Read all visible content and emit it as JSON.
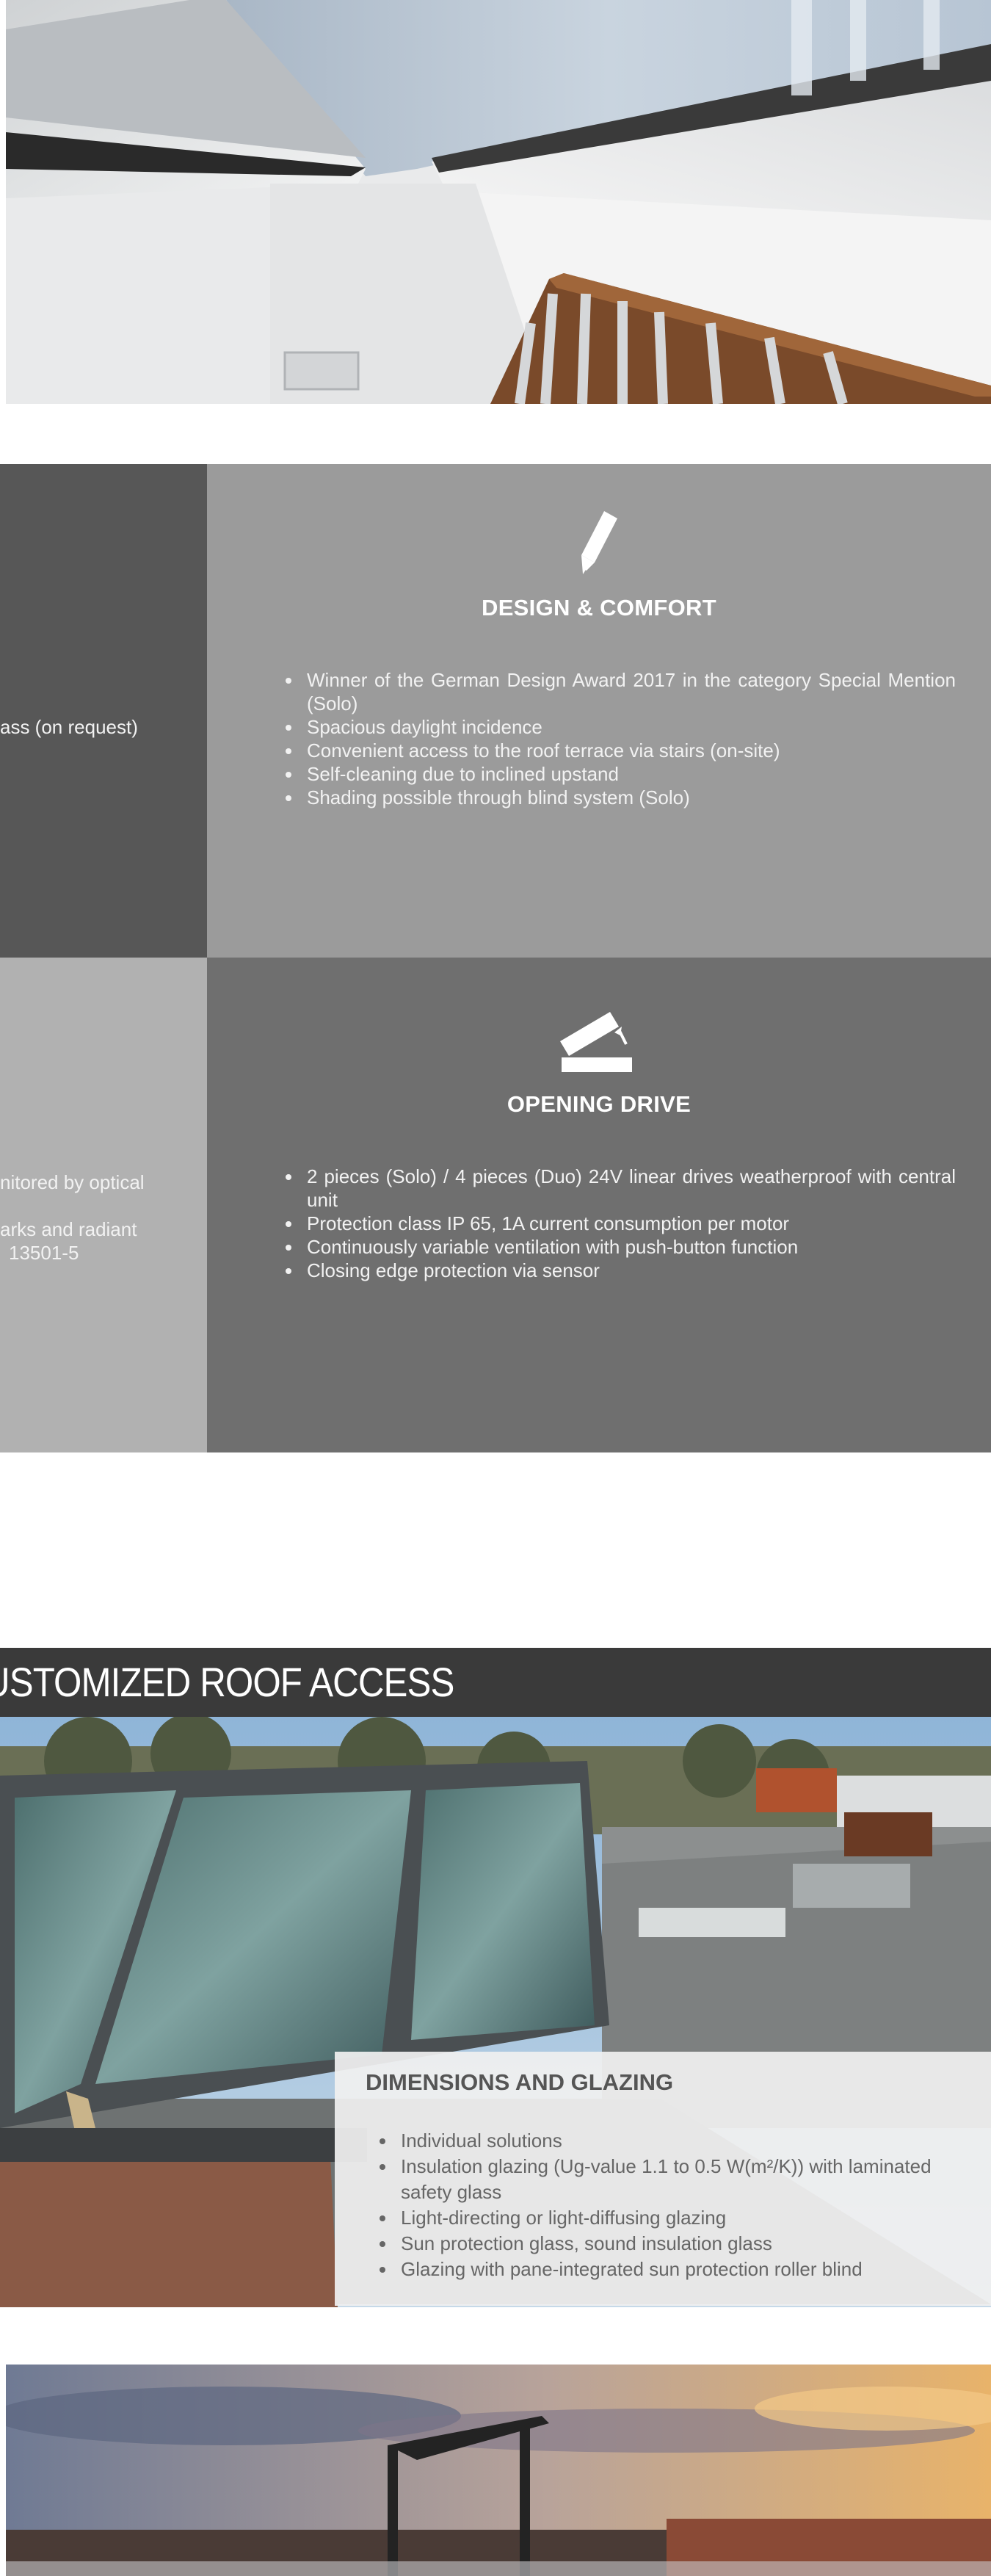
{
  "design_comfort": {
    "title": "DESIGN & COMFORT",
    "icon": "pencil-icon",
    "items": [
      "Winner of the German Design Award 2017 in the category Special Mention (Solo)",
      "Spacious daylight incidence",
      "Convenient access to the roof terrace via stairs (on-site)",
      "Self-cleaning due to inclined upstand",
      "Shading possible through blind system (Solo)"
    ]
  },
  "left_dark_cell": {
    "fragment": "ass (on request)"
  },
  "opening_drive": {
    "title": "OPENING DRIVE",
    "icon": "opening-window-icon",
    "items": [
      "2 pieces (Solo) / 4 pieces (Duo) 24V linear drives weatherproof with central unit",
      "Protection class IP 65, 1A current consumption per motor",
      "Continuously variable ventilation with push-button function",
      "Closing edge protection via sensor"
    ]
  },
  "left_light_cell": {
    "fragment_1": "nitored by optical",
    "fragment_2": "arks and radiant",
    "fragment_3": "13501-5"
  },
  "banner": {
    "title": "USTOMIZED ROOF ACCESS"
  },
  "glazing": {
    "title": "DIMENSIONS AND GLAZING",
    "items": [
      "Individual solutions",
      "Insulation glazing (Ug-value 1.1 to 0.5 W(m²/K)) with laminated safety glass",
      "Light-directing or light-diffusing glazing",
      "Sun protection glass, sound insulation glass",
      "Glazing with pane-integrated sun protection roller blind"
    ]
  },
  "colors": {
    "banner_bg": "#3a3a3a",
    "cell_dark": "#575757",
    "cell_mid_light": "#9b9b9b",
    "cell_light": "#b1b1b1",
    "cell_mid_dark": "#6f6f6f"
  }
}
